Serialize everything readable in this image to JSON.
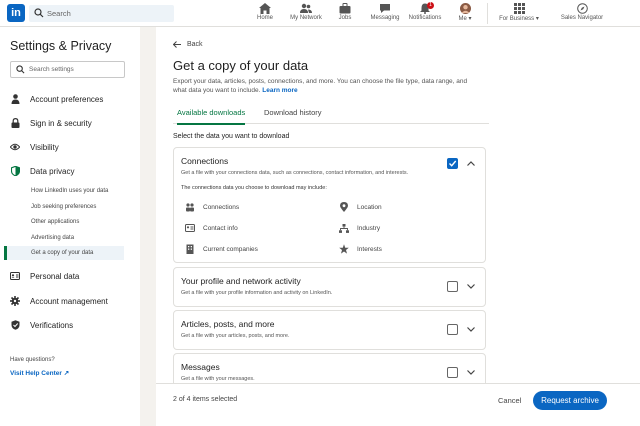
{
  "topnav": {
    "logo": "in",
    "search_placeholder": "Search",
    "items": [
      {
        "label": "Home",
        "icon": "home-icon"
      },
      {
        "label": "My Network",
        "icon": "network-icon"
      },
      {
        "label": "Jobs",
        "icon": "briefcase-icon"
      },
      {
        "label": "Messaging",
        "icon": "messaging-icon"
      },
      {
        "label": "Notifications",
        "icon": "bell-icon",
        "badge": "1"
      },
      {
        "label": "Me",
        "icon": "avatar"
      },
      {
        "label": "For Business",
        "icon": "grid-icon"
      },
      {
        "label": "Sales Navigator",
        "icon": "compass-icon"
      }
    ],
    "brand_color": "#0a66c2"
  },
  "sidebar": {
    "title": "Settings & Privacy",
    "search_placeholder": "Search settings",
    "items": [
      {
        "label": "Account preferences",
        "icon": "person-icon"
      },
      {
        "label": "Sign in & security",
        "icon": "lock-icon"
      },
      {
        "label": "Visibility",
        "icon": "eye-icon"
      },
      {
        "label": "Data privacy",
        "icon": "shield-icon"
      },
      {
        "label": "Personal data",
        "icon": "id-card-icon"
      },
      {
        "label": "Account management",
        "icon": "gear-icon"
      },
      {
        "label": "Verifications",
        "icon": "verified-shield-icon"
      }
    ],
    "subitems": [
      {
        "label": "How LinkedIn uses your data"
      },
      {
        "label": "Job seeking preferences"
      },
      {
        "label": "Other applications"
      },
      {
        "label": "Advertising data"
      },
      {
        "label": "Get a copy of your data",
        "active": true
      }
    ],
    "help_text": "Have questions?",
    "help_link": "Visit Help Center"
  },
  "main": {
    "back_label": "Back",
    "title": "Get a copy of your data",
    "description": "Export your data, articles, posts, connections, and more. You can choose the file type, data range, and what data you want to include.",
    "learn_more": "Learn more",
    "tabs": [
      {
        "label": "Available downloads",
        "active": true
      },
      {
        "label": "Download history",
        "active": false
      }
    ],
    "select_label": "Select the data you want to download",
    "cards": [
      {
        "title": "Connections",
        "description": "Get a file with your connections data, such as connections, contact information, and interests.",
        "checked": true,
        "expanded": true,
        "includes_label": "The connections data you choose to download may include:",
        "data_types": [
          {
            "label": "Connections",
            "icon": "people-icon"
          },
          {
            "label": "Location",
            "icon": "location-pin-icon"
          },
          {
            "label": "Contact info",
            "icon": "contact-card-icon"
          },
          {
            "label": "Industry",
            "icon": "hierarchy-icon"
          },
          {
            "label": "Current companies",
            "icon": "building-icon"
          },
          {
            "label": "Interests",
            "icon": "star-icon"
          }
        ]
      },
      {
        "title": "Your profile and network activity",
        "description": "Get a file with your profile information and activity on LinkedIn.",
        "checked": false
      },
      {
        "title": "Articles, posts, and more",
        "description": "Get a file with your articles, posts, and more.",
        "checked": false
      },
      {
        "title": "Messages",
        "description": "Get a file with your messages.",
        "checked": false
      }
    ]
  },
  "footer": {
    "count_text": "2 of 4 items selected",
    "cancel_label": "Cancel",
    "primary_label": "Request archive"
  }
}
